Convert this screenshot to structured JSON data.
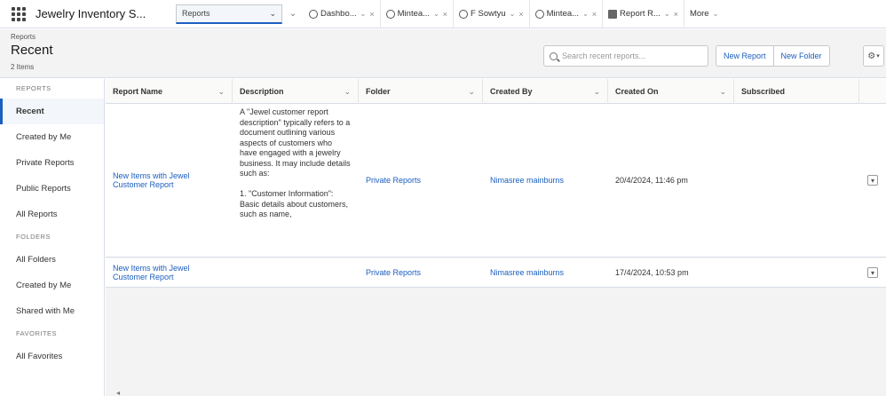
{
  "nav": {
    "app_name": "Jewelry Inventory S...",
    "current_object": "Reports",
    "tabs": [
      {
        "label": "Dashbo...",
        "icon": "dashboard-icon"
      },
      {
        "label": "Mintea...",
        "icon": "dashboard-icon"
      },
      {
        "label": "F Sowtyu",
        "icon": "dashboard-icon"
      },
      {
        "label": "Mintea...",
        "icon": "dashboard-icon"
      },
      {
        "label": "Report R...",
        "icon": "report-icon"
      }
    ],
    "more_label": "More"
  },
  "header": {
    "breadcrumb": "Reports",
    "title": "Recent",
    "item_count": "2 Items",
    "search_placeholder": "Search recent reports...",
    "new_report_label": "New Report",
    "new_folder_label": "New Folder"
  },
  "sidebar": {
    "sections": [
      {
        "title": "REPORTS",
        "items": [
          "Recent",
          "Created by Me",
          "Private Reports",
          "Public Reports",
          "All Reports"
        ]
      },
      {
        "title": "FOLDERS",
        "items": [
          "All Folders",
          "Created by Me",
          "Shared with Me"
        ]
      },
      {
        "title": "FAVORITES",
        "items": [
          "All Favorites"
        ]
      }
    ],
    "active_item": "Recent"
  },
  "table": {
    "columns": [
      "Report Name",
      "Description",
      "Folder",
      "Created By",
      "Created On",
      "Subscribed"
    ],
    "rows": [
      {
        "name": "New Items with Jewel Customer Report",
        "description": "A \"Jewel customer report description\" typically refers to a document outlining various aspects of customers who have engaged with a jewelry business. It may include details such as:\n\n1. \"Customer Information\": Basic details about customers, such as name,",
        "folder": "Private Reports",
        "created_by": "Nimasree mainburns",
        "created_on": "20/4/2024, 11:46 pm",
        "subscribed": ""
      },
      {
        "name": "New Items with Jewel Customer Report",
        "description": "",
        "folder": "Private Reports",
        "created_by": "Nimasree mainburns",
        "created_on": "17/4/2024, 10:53 pm",
        "subscribed": ""
      }
    ]
  },
  "colors": {
    "accent": "#1b5fbf",
    "header_bg": "#f3f3f3",
    "border": "#d8dde6"
  }
}
